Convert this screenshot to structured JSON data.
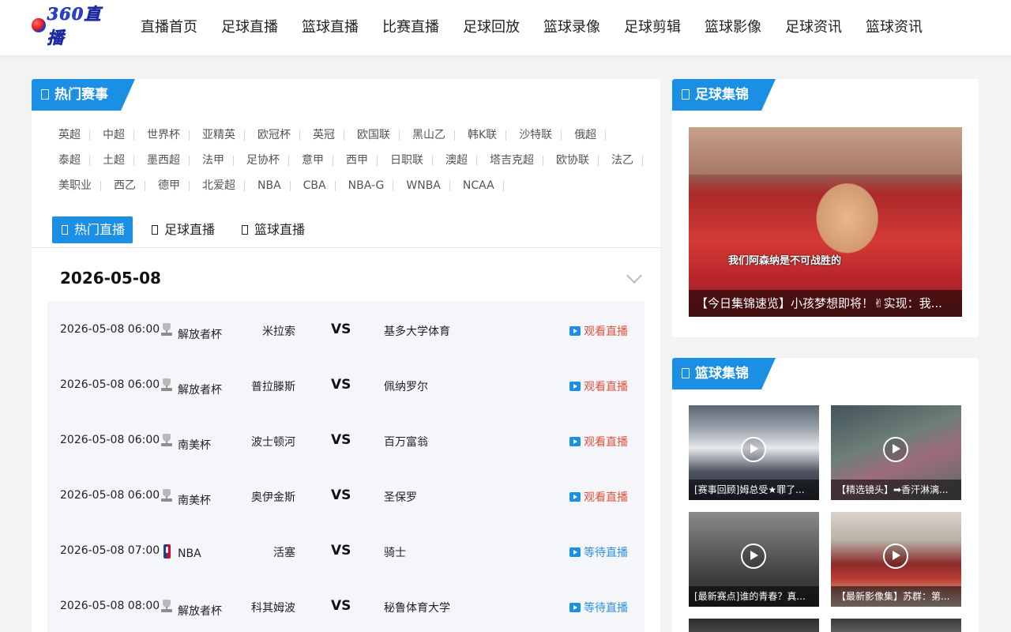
{
  "header": {
    "logo_text": "360直播",
    "nav": [
      "直播首页",
      "足球直播",
      "篮球直播",
      "比赛直播",
      "足球回放",
      "篮球录像",
      "足球剪辑",
      "篮球影像",
      "足球资讯",
      "篮球资讯"
    ]
  },
  "hot_events": {
    "title": "热门赛事",
    "leagues": [
      [
        "英超",
        "中超",
        "世界杯",
        "亚精英",
        "欧冠杯",
        "英冠",
        "欧国联",
        "黑山乙",
        "韩K联",
        "沙特联",
        "俄超"
      ],
      [
        "泰超",
        "土超",
        "墨西超",
        "法甲",
        "足协杯",
        "意甲",
        "西甲",
        "日职联",
        "澳超",
        "塔吉克超",
        "欧协联",
        "法乙"
      ],
      [
        "美职业",
        "西乙",
        "德甲",
        "北爱超",
        "NBA",
        "CBA",
        "NBA-G",
        "WNBA",
        "NCAA"
      ]
    ]
  },
  "tabs": [
    "热门直播",
    "足球直播",
    "篮球直播"
  ],
  "schedule": {
    "date": "2026-05-08",
    "vs_label": "VS",
    "matches": [
      {
        "time": "2026-05-08 06:00",
        "icon": "trophy-icon",
        "league": "解放者杯",
        "home": "米拉索",
        "away": "基多大学体育",
        "action": "观看直播",
        "live": true
      },
      {
        "time": "2026-05-08 06:00",
        "icon": "trophy-icon",
        "league": "解放者杯",
        "home": "普拉滕斯",
        "away": "佩纳罗尔",
        "action": "观看直播",
        "live": true
      },
      {
        "time": "2026-05-08 06:00",
        "icon": "trophy-icon",
        "league": "南美杯",
        "home": "波士顿河",
        "away": "百万富翁",
        "action": "观看直播",
        "live": true
      },
      {
        "time": "2026-05-08 06:00",
        "icon": "trophy-icon",
        "league": "南美杯",
        "home": "奥伊金斯",
        "away": "圣保罗",
        "action": "观看直播",
        "live": true
      },
      {
        "time": "2026-05-08 07:00",
        "icon": "nba-logo-icon",
        "league": "NBA",
        "home": "活塞",
        "away": "骑士",
        "action": "等待直播",
        "live": false
      },
      {
        "time": "2026-05-08 08:00",
        "icon": "trophy-icon",
        "league": "解放者杯",
        "home": "科其姆波",
        "away": "秘鲁体育大学",
        "action": "等待直播",
        "live": false
      }
    ]
  },
  "football_highlights": {
    "title": "足球集锦",
    "video_subtitle": "我们阿森纳是不可战胜的",
    "video_caption": "【今日集锦速览】小孩梦想即将！✌实现：我..."
  },
  "basketball_highlights": {
    "title": "篮球集锦",
    "videos": [
      {
        "caption": "[赛事回顾]姆总受★罪了..."
      },
      {
        "caption": "【精选镜头】➡香汗淋漓..."
      },
      {
        "caption": "[最新赛点]谁的青春？真..."
      },
      {
        "caption": "【最新影像集】苏群：第..."
      }
    ]
  },
  "colors": {
    "brand_blue": "#1a8fe3",
    "live_red": "#e0503f",
    "waiting_blue": "#2f8fe0"
  }
}
